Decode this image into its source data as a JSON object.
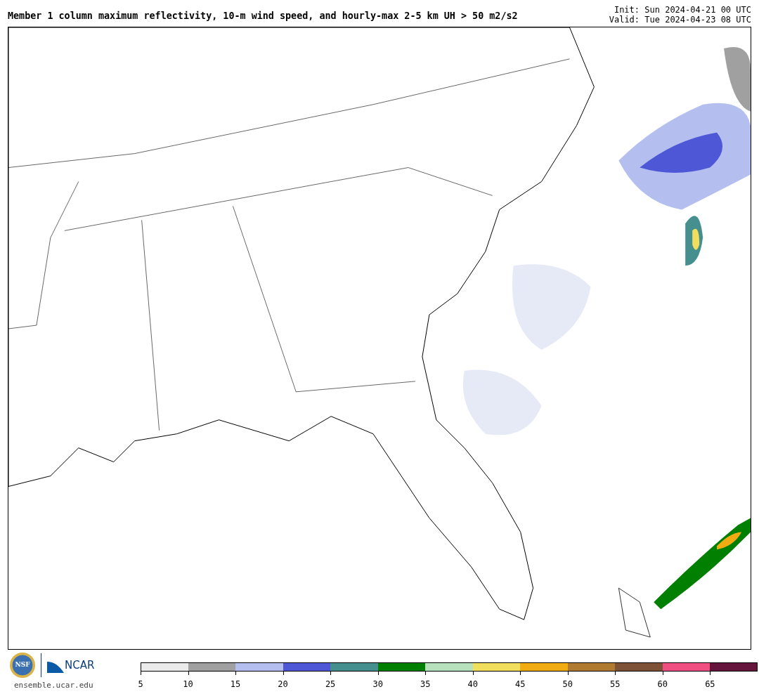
{
  "title": "Member 1 column maximum reflectivity, 10-m wind speed, and hourly-max 2-5 km UH > 50 m2/s2",
  "run_info": [
    "Init: Sun 2024-04-21 00 UTC",
    "Valid: Tue 2024-04-23 08 UTC"
  ],
  "logos": {
    "nsf": "NSF",
    "ncar": "NCAR",
    "website": "ensemble.ucar.edu"
  },
  "colorbar": [
    {
      "color": "#ebebeb",
      "label": "5"
    },
    {
      "color": "#a0a0a0",
      "label": "10"
    },
    {
      "color": "#b4bff0",
      "label": "15"
    },
    {
      "color": "#4e58d6",
      "label": "20"
    },
    {
      "color": "#45908f",
      "label": "25"
    },
    {
      "color": "#007f00",
      "label": "30"
    },
    {
      "color": "#b7e0bd",
      "label": "35"
    },
    {
      "color": "#f0de5c",
      "label": "40"
    },
    {
      "color": "#f2ac13",
      "label": "45"
    },
    {
      "color": "#b07b30",
      "label": "50"
    },
    {
      "color": "#7e5236",
      "label": "55"
    },
    {
      "color": "#f05081",
      "label": "60"
    },
    {
      "color": "#65143b",
      "label": "65"
    }
  ]
}
